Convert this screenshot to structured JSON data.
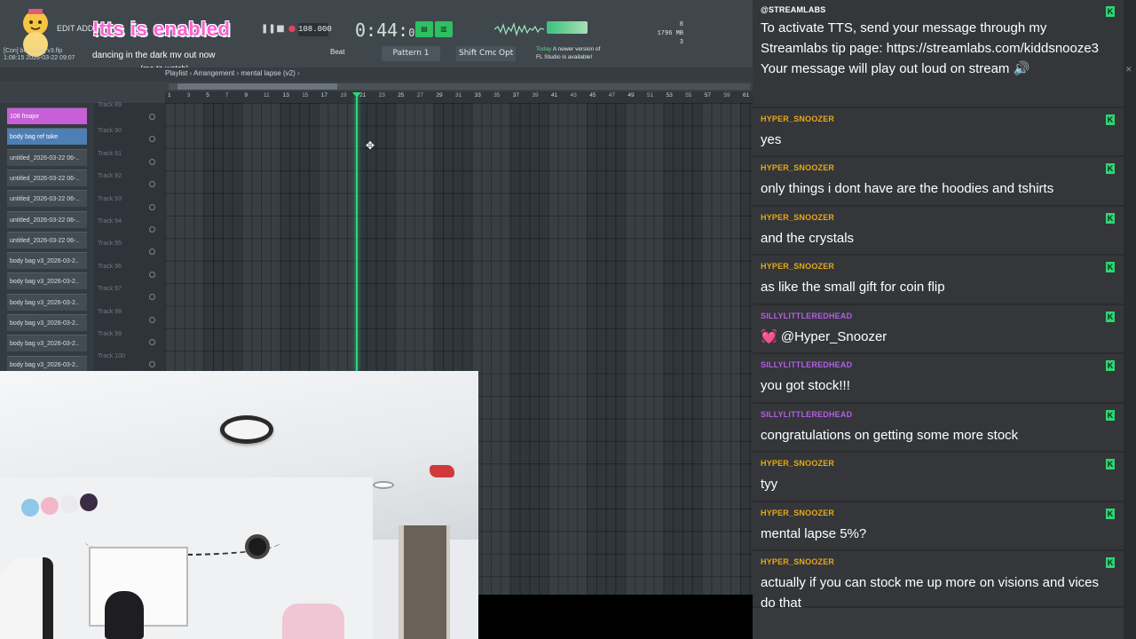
{
  "overlay": {
    "tts_banner": "!tts is enabled",
    "now_playing": "dancing in the dark mv out now",
    "now_playing_sub": "(me to watch)"
  },
  "fl": {
    "menu_edit": "EDIT ADD",
    "file_line1": "[Con] body bag v3.flp",
    "file_line2": "1:08:15 2026-03-22 09:07",
    "tempo": "108.000",
    "time_main": "0:44:",
    "time_frac": "02",
    "cpu_mem": "1796 MB",
    "cpu_a": "8",
    "cpu_b": "3",
    "mode_beat": "Beat",
    "pattern": "Pattern 1",
    "btn_shift": "Shift",
    "btn_cmd": "Cmd",
    "btn_opt": "Opt",
    "news_today": "Today",
    "news_line1": "A newer version of",
    "news_line2": "FL Studio is available!",
    "breadcrumb_root": "Playlist",
    "breadcrumb_mid": "Arrangement",
    "breadcrumb_leaf": "mental lapse (v2)",
    "ruler": [
      "1",
      "5",
      "9",
      "13",
      "17",
      "21",
      "25",
      "29",
      "33",
      "37",
      "41",
      "45",
      "49",
      "53",
      "57",
      "61"
    ],
    "ruler_minor": [
      "3",
      "7",
      "11",
      "15",
      "19",
      "23",
      "27",
      "31",
      "35",
      "39",
      "43",
      "47",
      "51",
      "55",
      "59"
    ],
    "picker": [
      {
        "label": "108 fmajor",
        "style": "pink"
      },
      {
        "label": "body bag ref take",
        "style": "blue"
      },
      {
        "label": "untitled_2026-03-22 06-..",
        "style": "plain"
      },
      {
        "label": "untitled_2026-03-22 06-..",
        "style": "plain"
      },
      {
        "label": "untitled_2026-03-22 06-..",
        "style": "plain"
      },
      {
        "label": "untitled_2026-03-22 06-..",
        "style": "plain"
      },
      {
        "label": "untitled_2026-03-22 06-..",
        "style": "plain"
      },
      {
        "label": "body bag v3_2026-03-2..",
        "style": "plain"
      },
      {
        "label": "body bag v3_2026-03-2..",
        "style": "plain"
      },
      {
        "label": "body bag v3_2026-03-2..",
        "style": "plain"
      },
      {
        "label": "body bag v3_2026-03-2..",
        "style": "plain"
      },
      {
        "label": "body bag v3_2026-03-2..",
        "style": "plain"
      },
      {
        "label": "body bag v3_2026-03-2..",
        "style": "plain"
      }
    ],
    "tracks": [
      "Track 89",
      "Track 90",
      "Track 91",
      "Track 92",
      "Track 93",
      "Track 94",
      "Track 95",
      "Track 96",
      "Track 97",
      "Track 98",
      "Track 99",
      "Track 100"
    ]
  },
  "chat": {
    "messages": [
      {
        "user": "@STREAMLABS",
        "color": "#ffffff",
        "text": "To activate TTS, send your message through my Streamlabs tip page: https://streamlabs.com/kiddsnooze3 Your message will play out loud on stream 🔊"
      },
      {
        "user": "HYPER_SNOOZER",
        "color": "#e6a817",
        "text": "yes"
      },
      {
        "user": "HYPER_SNOOZER",
        "color": "#e6a817",
        "text": "only things i dont have are the hoodies and tshirts"
      },
      {
        "user": "HYPER_SNOOZER",
        "color": "#e6a817",
        "text": "and the crystals"
      },
      {
        "user": "HYPER_SNOOZER",
        "color": "#e6a817",
        "text": "as like the small gift for coin flip"
      },
      {
        "user": "SILLYLITTLEREDHEAD",
        "color": "#b25fe3",
        "text": "💓 @Hyper_Snoozer"
      },
      {
        "user": "SILLYLITTLEREDHEAD",
        "color": "#b25fe3",
        "text": "you got stock!!!"
      },
      {
        "user": "SILLYLITTLEREDHEAD",
        "color": "#b25fe3",
        "text": "congratulations on getting some more stock"
      },
      {
        "user": "HYPER_SNOOZER",
        "color": "#e6a817",
        "text": "tyy"
      },
      {
        "user": "HYPER_SNOOZER",
        "color": "#e6a817",
        "text": "mental lapse 5%?"
      },
      {
        "user": "HYPER_SNOOZER",
        "color": "#e6a817",
        "text": "actually if you can stock me up more on visions and vices do that"
      }
    ],
    "badge": "K"
  }
}
